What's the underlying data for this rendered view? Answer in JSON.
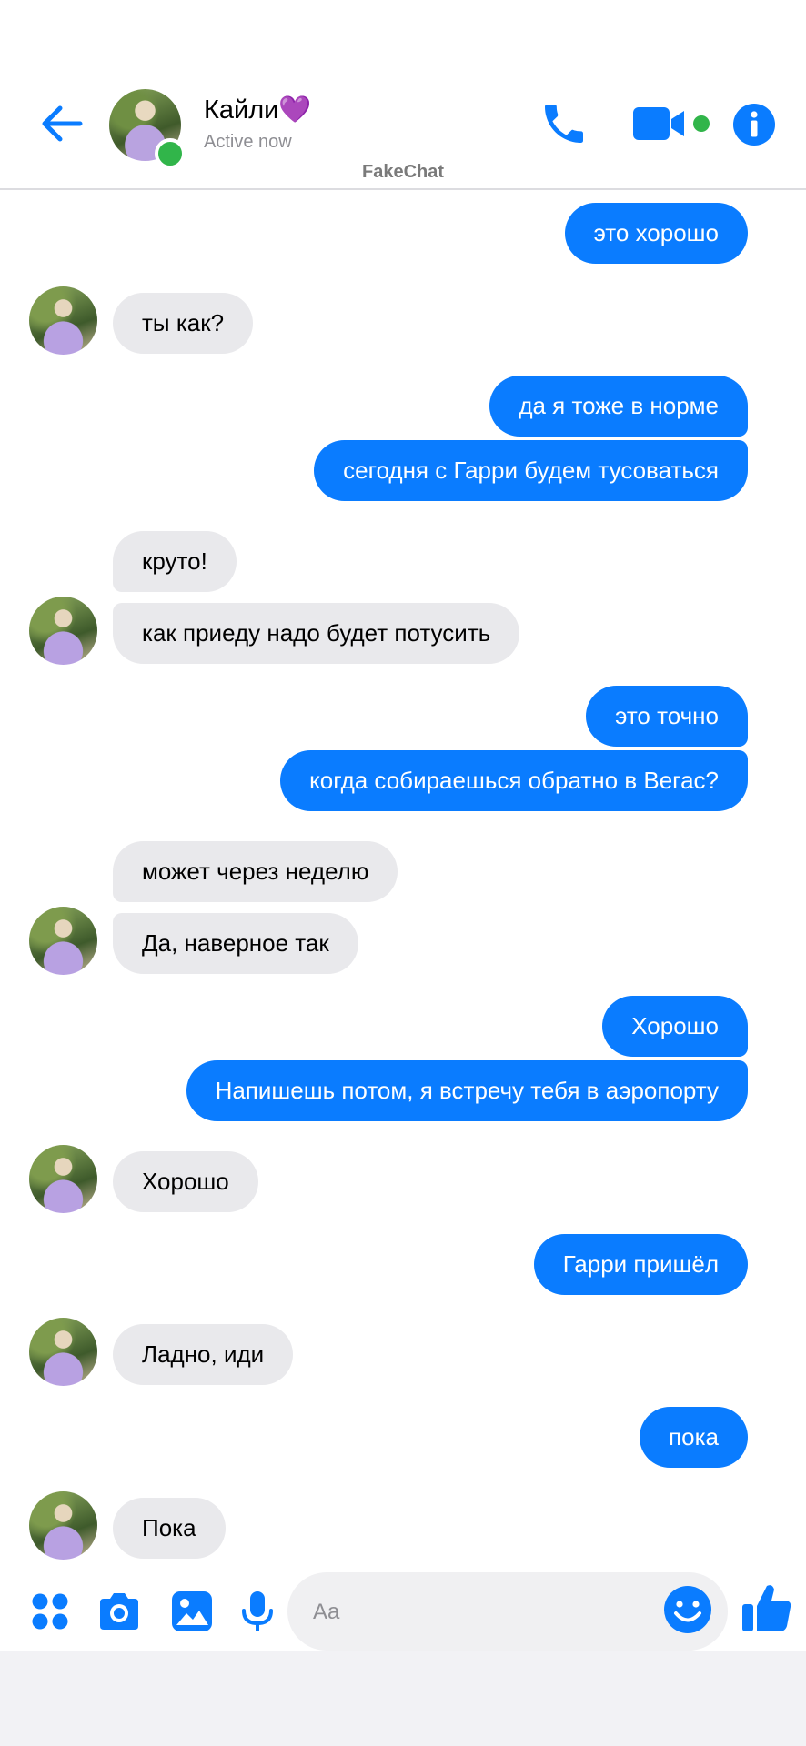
{
  "header": {
    "contact_name": "Кайли💜",
    "status": "Active now",
    "watermark": "FakeChat",
    "accent": "#0a7cff",
    "online_color": "#31b54a"
  },
  "messages": [
    {
      "dir": "out",
      "text": "это хорошо"
    },
    {
      "dir": "in",
      "text": "ты как?"
    },
    {
      "dir": "out",
      "text": "да я тоже в норме"
    },
    {
      "dir": "out",
      "text": "сегодня с Гарри будем тусоваться"
    },
    {
      "dir": "in",
      "text": "круто!"
    },
    {
      "dir": "in",
      "text": "как приеду надо будет потусить"
    },
    {
      "dir": "out",
      "text": "это точно"
    },
    {
      "dir": "out",
      "text": "когда собираешься обратно в Вегас?"
    },
    {
      "dir": "in",
      "text": "может через неделю"
    },
    {
      "dir": "in",
      "text": "Да,  наверное так"
    },
    {
      "dir": "out",
      "text": "Хорошо"
    },
    {
      "dir": "out",
      "text": "Напишешь потом, я встречу тебя в аэропорту"
    },
    {
      "dir": "in",
      "text": "Хорошо"
    },
    {
      "dir": "out",
      "text": "Гарри пришёл"
    },
    {
      "dir": "in",
      "text": "Ладно, иди"
    },
    {
      "dir": "out",
      "text": "пока"
    },
    {
      "dir": "in",
      "text": "Пока"
    }
  ],
  "composer": {
    "placeholder": "Aa",
    "icons": [
      "apps-icon",
      "camera-icon",
      "gallery-icon",
      "microphone-icon",
      "emoji-icon",
      "thumbs-up-icon"
    ]
  }
}
